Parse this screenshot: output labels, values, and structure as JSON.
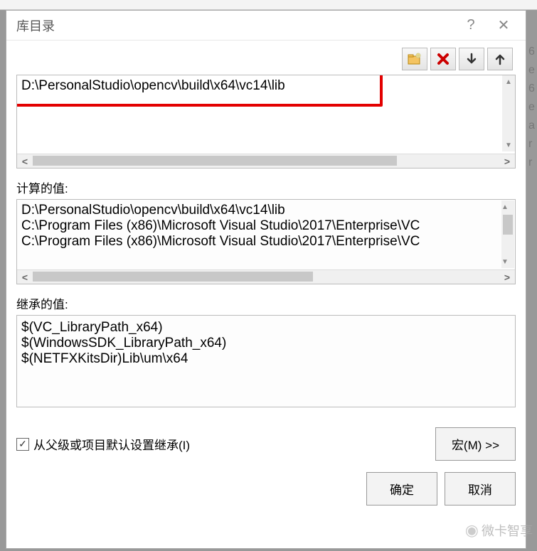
{
  "dialog": {
    "title": "库目录",
    "help_glyph": "?",
    "close_glyph": "✕"
  },
  "toolbar": {
    "new_folder_icon": "folder-new-icon",
    "delete_icon": "delete-icon",
    "down_icon": "arrow-down-icon",
    "up_icon": "arrow-up-icon"
  },
  "user_entries": {
    "lines": [
      "D:\\PersonalStudio\\opencv\\build\\x64\\vc14\\lib"
    ]
  },
  "computed": {
    "label": "计算的值:",
    "lines": [
      "D:\\PersonalStudio\\opencv\\build\\x64\\vc14\\lib",
      "C:\\Program Files (x86)\\Microsoft Visual Studio\\2017\\Enterprise\\VC",
      "C:\\Program Files (x86)\\Microsoft Visual Studio\\2017\\Enterprise\\VC"
    ]
  },
  "inherited": {
    "label": "继承的值:",
    "lines": [
      "$(VC_LibraryPath_x64)",
      "$(WindowsSDK_LibraryPath_x64)",
      "$(NETFXKitsDir)Lib\\um\\x64"
    ]
  },
  "inherit_checkbox": {
    "checked": true,
    "label": "从父级或项目默认设置继承(I)"
  },
  "buttons": {
    "macro": "宏(M) >>",
    "ok": "确定",
    "cancel": "取消"
  },
  "watermark": {
    "text": "微卡智享"
  },
  "rightstrip": [
    "6",
    "e",
    "6",
    "e",
    "a",
    "",
    "r",
    "r"
  ]
}
